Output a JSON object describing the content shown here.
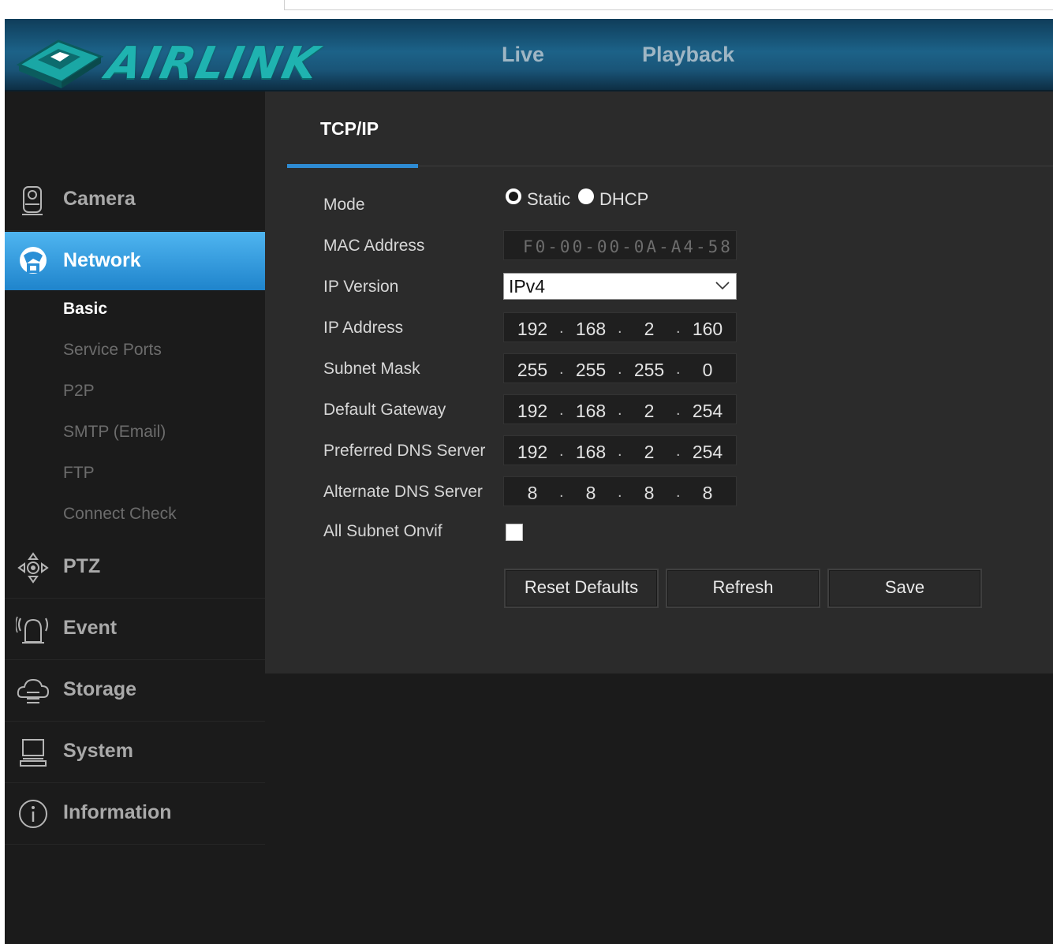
{
  "header": {
    "logo_text": "AIRLINK",
    "nav": [
      {
        "label": "Live"
      },
      {
        "label": "Playback"
      }
    ]
  },
  "sidebar": {
    "items": [
      {
        "label": "Camera",
        "icon": "camera-icon"
      },
      {
        "label": "Network",
        "icon": "network-icon",
        "active": true
      },
      {
        "label": "PTZ",
        "icon": "ptz-icon"
      },
      {
        "label": "Event",
        "icon": "alarm-icon"
      },
      {
        "label": "Storage",
        "icon": "cloud-storage-icon"
      },
      {
        "label": "System",
        "icon": "computer-icon"
      },
      {
        "label": "Information",
        "icon": "info-icon"
      }
    ],
    "network_sub": [
      {
        "label": "Basic",
        "active": true
      },
      {
        "label": "Service Ports"
      },
      {
        "label": "P2P"
      },
      {
        "label": "SMTP (Email)"
      },
      {
        "label": "FTP"
      },
      {
        "label": "Connect Check"
      }
    ]
  },
  "content": {
    "tab": "TCP/IP",
    "labels": {
      "mode": "Mode",
      "mac": "MAC Address",
      "ip_version": "IP Version",
      "ip_address": "IP Address",
      "subnet": "Subnet Mask",
      "gateway": "Default Gateway",
      "dns1": "Preferred DNS Server",
      "dns2": "Alternate DNS Server",
      "onvif": "All Subnet Onvif"
    },
    "mode": {
      "options": [
        "Static",
        "DHCP"
      ],
      "selected": "Static"
    },
    "mac_value": "F0-00-00-0A-A4-58",
    "ip_version_value": "IPv4",
    "ip_address": [
      "192",
      "168",
      "2",
      "160"
    ],
    "subnet": [
      "255",
      "255",
      "255",
      "0"
    ],
    "gateway": [
      "192",
      "168",
      "2",
      "254"
    ],
    "dns1": [
      "192",
      "168",
      "2",
      "254"
    ],
    "dns2": [
      "8",
      "8",
      "8",
      "8"
    ],
    "onvif_checked": false,
    "buttons": {
      "reset": "Reset Defaults",
      "refresh": "Refresh",
      "save": "Save"
    }
  },
  "colors": {
    "accent": "#2e8bd3",
    "logo": "#1fb3b0",
    "panel": "#2b2b2b",
    "sidebar": "#1b1b1b"
  }
}
